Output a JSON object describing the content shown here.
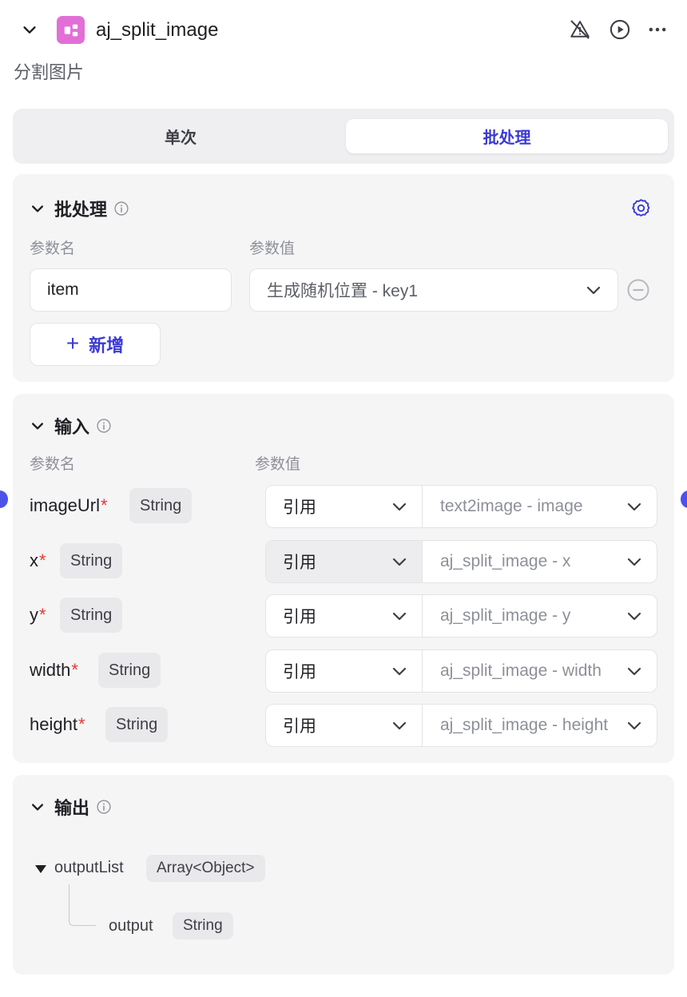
{
  "header": {
    "title": "aj_split_image",
    "subtitle": "分割图片",
    "icon_color": "#e26fd7"
  },
  "mode": {
    "single_label": "单次",
    "batch_label": "批处理",
    "active": "batch"
  },
  "batch": {
    "title": "批处理",
    "col_name": "参数名",
    "col_value": "参数值",
    "item_name": "item",
    "item_value": "生成随机位置 - key1",
    "add_label": "新增"
  },
  "input": {
    "title": "输入",
    "col_name": "参数名",
    "col_value": "参数值",
    "rows": [
      {
        "name": "imageUrl",
        "required": "*",
        "type": "String",
        "ref_type": "引用",
        "ref_value": "text2image - image"
      },
      {
        "name": "x",
        "required": "*",
        "type": "String",
        "ref_type": "引用",
        "ref_value": "aj_split_image - x"
      },
      {
        "name": "y",
        "required": "*",
        "type": "String",
        "ref_type": "引用",
        "ref_value": "aj_split_image - y"
      },
      {
        "name": "width",
        "required": "*",
        "type": "String",
        "ref_type": "引用",
        "ref_value": "aj_split_image - width"
      },
      {
        "name": "height",
        "required": "*",
        "type": "String",
        "ref_type": "引用",
        "ref_value": "aj_split_image - height"
      }
    ]
  },
  "output": {
    "title": "输出",
    "root_name": "outputList",
    "root_type": "Array<Object>",
    "child_name": "output",
    "child_type": "String"
  },
  "colors": {
    "accent": "#3a3ad6",
    "required": "#e53935",
    "handle": "#4d53e8"
  }
}
